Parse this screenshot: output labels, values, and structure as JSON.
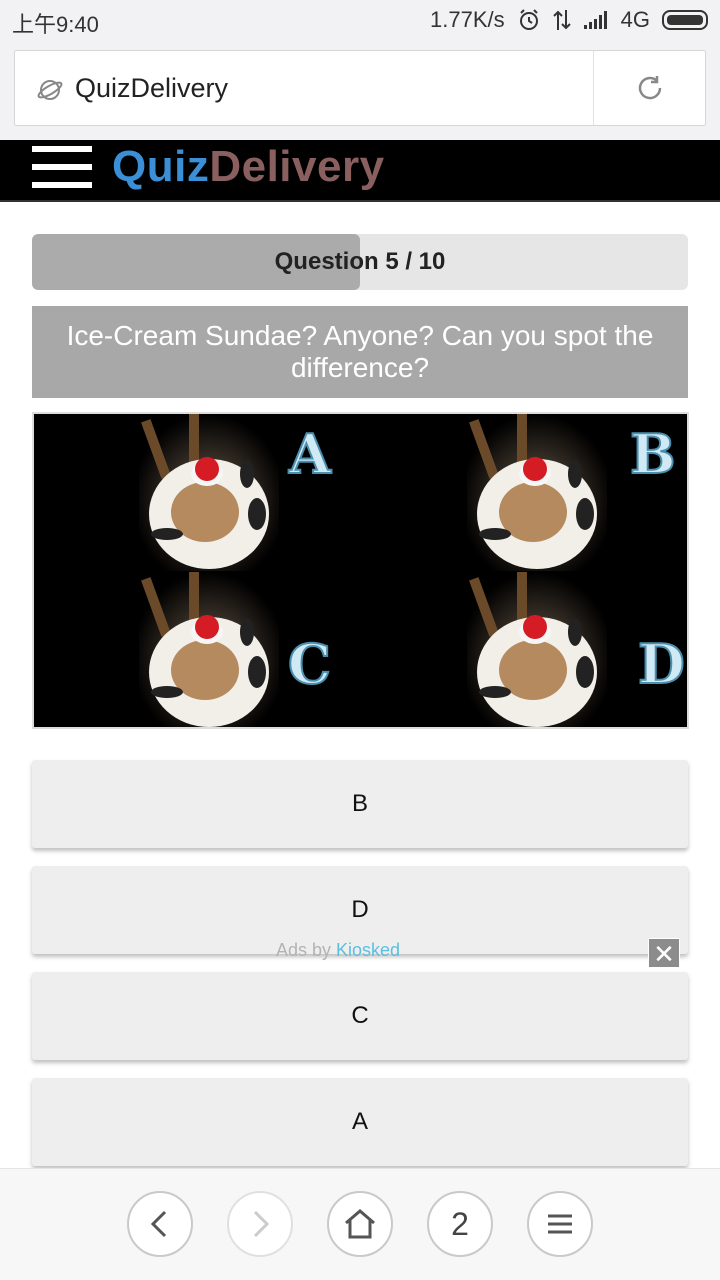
{
  "status_bar": {
    "time": "上午9:40",
    "speed": "1.77K/s",
    "network": "4G"
  },
  "browser": {
    "url_text": "QuizDelivery",
    "tabs_count": "2"
  },
  "site": {
    "logo_part1": "Quiz",
    "logo_part2": "Delivery"
  },
  "quiz": {
    "progress_label": "Question 5 / 10",
    "progress_fraction": 0.5,
    "question": "Ice-Cream Sundae? Anyone? Can you spot the difference?",
    "image_letters": [
      "A",
      "B",
      "C",
      "D"
    ],
    "answers": [
      "B",
      "D",
      "C",
      "A"
    ]
  },
  "ad": {
    "prefix": "Ads by ",
    "brand": "Kiosked",
    "close_symbol": "✕"
  },
  "icons": {
    "alarm": "alarm-icon",
    "data": "data-transfer-icon",
    "signal": "signal-icon",
    "battery": "battery-icon",
    "globe": "globe-icon",
    "reload": "reload-icon",
    "menu": "hamburger-icon"
  },
  "colors": {
    "logo_quiz": "#3a8fd6",
    "logo_delivery": "#8a5f5f",
    "ad_brand": "#5bbfe0"
  }
}
